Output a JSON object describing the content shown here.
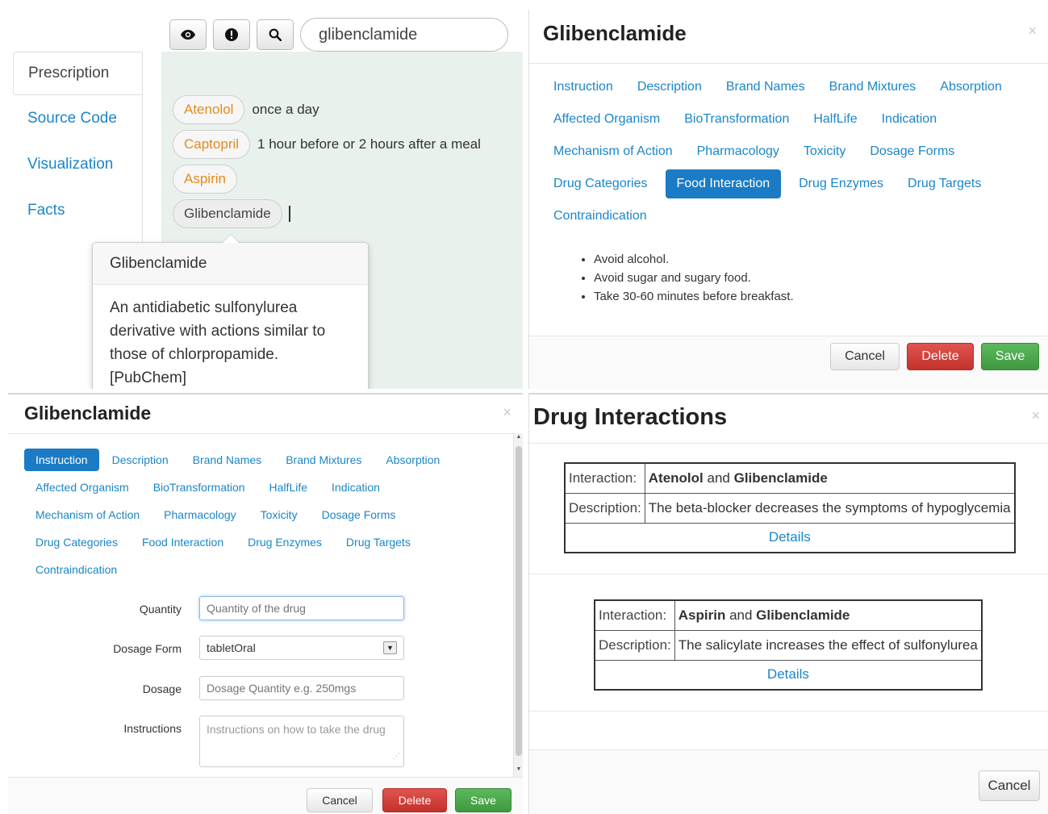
{
  "editor": {
    "tabs": [
      {
        "label": "Prescription"
      },
      {
        "label": "Source Code"
      },
      {
        "label": "Visualization"
      },
      {
        "label": "Facts"
      }
    ],
    "toolbar": {
      "view_icon": "eye-icon",
      "alert_icon": "exclamation-icon",
      "search_icon": "search-icon",
      "search_value": "glibenclamide"
    },
    "lines": [
      {
        "drug": "Atenolol",
        "note": "once a day"
      },
      {
        "drug": "Captopril",
        "note": "1 hour before or 2 hours after a meal"
      },
      {
        "drug": "Aspirin",
        "note": ""
      },
      {
        "drug": "Glibenclamide",
        "note": ""
      }
    ],
    "popover": {
      "title": "Glibenclamide",
      "body": "An antidiabetic sulfonylurea derivative with actions similar to those of chlorpropamide. [PubChem]"
    }
  },
  "food_modal": {
    "title": "Glibenclamide",
    "close": "×",
    "links": [
      "Instruction",
      "Description",
      "Brand Names",
      "Brand Mixtures",
      "Absorption",
      "Affected Organism",
      "BioTransformation",
      "HalfLife",
      "Indication",
      "Mechanism of Action",
      "Pharmacology",
      "Toxicity",
      "Dosage Forms",
      "Drug Categories",
      "Food Interaction",
      "Drug Enzymes",
      "Drug Targets",
      "Contraindication"
    ],
    "active_link": "Food Interaction",
    "facts": [
      "Avoid alcohol.",
      "Avoid sugar and sugary food.",
      "Take 30-60 minutes before breakfast."
    ],
    "buttons": {
      "cancel": "Cancel",
      "delete": "Delete",
      "save": "Save"
    }
  },
  "form_modal": {
    "title": "Glibenclamide",
    "close": "×",
    "links": [
      "Instruction",
      "Description",
      "Brand Names",
      "Brand Mixtures",
      "Absorption",
      "Affected Organism",
      "BioTransformation",
      "HalfLife",
      "Indication",
      "Mechanism of Action",
      "Pharmacology",
      "Toxicity",
      "Dosage Forms",
      "Drug Categories",
      "Food Interaction",
      "Drug Enzymes",
      "Drug Targets",
      "Contraindication"
    ],
    "active_link": "Instruction",
    "fields": {
      "quantity_label": "Quantity",
      "quantity_placeholder": "Quantity of the drug",
      "dosage_form_label": "Dosage Form",
      "dosage_form_value": "tabletOral",
      "dosage_label": "Dosage",
      "dosage_placeholder": "Dosage Quantity e.g. 250mgs",
      "instructions_label": "Instructions",
      "instructions_placeholder": "Instructions on how to take the drug"
    },
    "buttons": {
      "cancel": "Cancel",
      "delete": "Delete",
      "save": "Save"
    }
  },
  "interactions_modal": {
    "title": "Drug Interactions",
    "close": "×",
    "interaction_label": "Interaction:",
    "description_label": "Description:",
    "details_label": "Details",
    "and_word": "and",
    "items": [
      {
        "drug_a": "Atenolol",
        "drug_b": "Glibenclamide",
        "description": "The beta-blocker decreases the symptoms of hypoglycemia"
      },
      {
        "drug_a": "Aspirin",
        "drug_b": "Glibenclamide",
        "description": "The salicylate increases the effect of sulfonylurea"
      }
    ],
    "cancel": "Cancel"
  },
  "colors": {
    "link": "#1b86c8",
    "active_link_bg": "#1b7bc5",
    "drug_pill_text": "#e58a1b",
    "editor_bg": "#e9f1ec",
    "danger": "#d2403b",
    "success": "#4cae4c"
  }
}
